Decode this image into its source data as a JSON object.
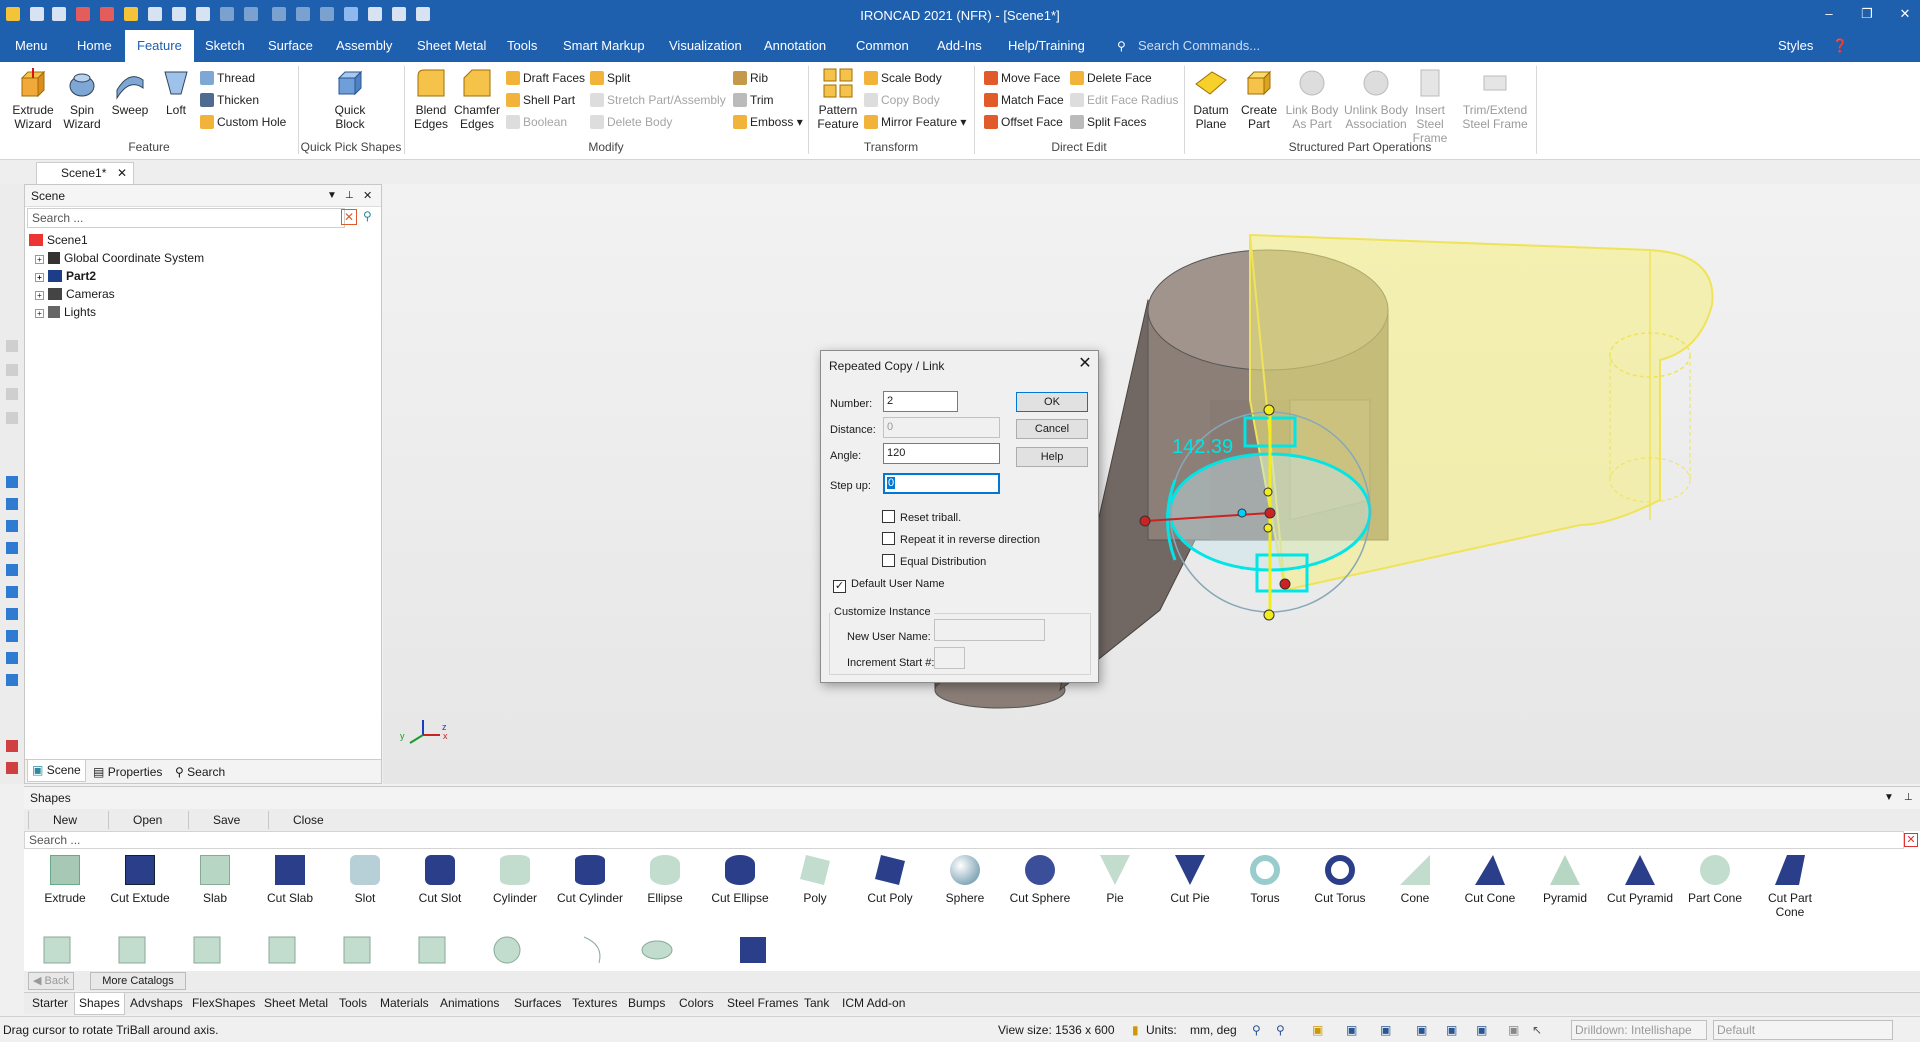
{
  "window": {
    "title": "IRONCAD 2021 (NFR) - [Scene1*]",
    "controls": [
      "–",
      "❐",
      "✕"
    ]
  },
  "menu": {
    "tabs": [
      "Menu",
      "Home",
      "Feature",
      "Sketch",
      "Surface",
      "Assembly",
      "Sheet Metal",
      "Tools",
      "Smart Markup",
      "Visualization",
      "Annotation",
      "Common",
      "Add-Ins",
      "Help/Training"
    ],
    "active": "Feature",
    "search_placeholder": "Search Commands...",
    "styles": "Styles"
  },
  "ribbon": {
    "groups": {
      "feature": "Feature",
      "quick": "Quick Pick Shapes",
      "modify": "Modify",
      "transform": "Transform",
      "direct": "Direct Edit",
      "structured": "Structured Part Operations"
    },
    "extrude": "Extrude Wizard",
    "spin": "Spin Wizard",
    "sweep": "Sweep",
    "loft": "Loft",
    "thread": "Thread",
    "thicken": "Thicken",
    "custom_hole": "Custom Hole",
    "quick_block": "Quick Block",
    "blend": "Blend Edges",
    "chamfer": "Chamfer Edges",
    "draft": "Draft Faces",
    "shell": "Shell Part",
    "boolean": "Boolean",
    "split": "Split",
    "stretch": "Stretch Part/Assembly",
    "delete_body": "Delete Body",
    "rib": "Rib",
    "trim": "Trim",
    "emboss": "Emboss",
    "pattern": "Pattern Feature",
    "scale": "Scale Body",
    "copy_body": "Copy Body",
    "mirror": "Mirror Feature",
    "move_face": "Move Face",
    "match_face": "Match Face",
    "offset_face": "Offset Face",
    "delete_face": "Delete Face",
    "edit_face_radius": "Edit Face Radius",
    "split_faces": "Split Faces",
    "datum": "Datum Plane",
    "create_part": "Create Part",
    "link_body": "Link Body As Part",
    "unlink_body": "Unlink Body Association",
    "insert_steel": "Insert Steel Frame",
    "trim_steel": "Trim/Extend Steel Frame"
  },
  "doc_tab": "Scene1*",
  "scene_panel": {
    "title": "Scene",
    "search": "Search ...",
    "root": "Scene1",
    "items": [
      "Global Coordinate System",
      "Part2",
      "Cameras",
      "Lights"
    ],
    "tabs": [
      "Scene",
      "Properties",
      "Search"
    ]
  },
  "viewport": {
    "dimension": "142.39",
    "axis": {
      "x": "x",
      "y": "y",
      "z": "z"
    }
  },
  "dialog": {
    "title": "Repeated Copy / Link",
    "number_label": "Number:",
    "number": "2",
    "distance_label": "Distance:",
    "distance": "0",
    "angle_label": "Angle:",
    "angle": "120",
    "stepup_label": "Step up:",
    "stepup": "0",
    "ok": "OK",
    "cancel": "Cancel",
    "help": "Help",
    "reset_triball": "Reset triball.",
    "reverse": "Repeat it in reverse direction",
    "equal": "Equal Distribution",
    "default_user_name": "Default User Name",
    "default_user_name_checked": true,
    "customize": "Customize Instance",
    "new_user_name": "New User Name:",
    "increment": "Increment Start #:"
  },
  "shapes": {
    "title": "Shapes",
    "toolbar": [
      "New",
      "Open",
      "Save",
      "Close"
    ],
    "search": "Search ...",
    "items": [
      "Extrude",
      "Cut Extude",
      "Slab",
      "Cut Slab",
      "Slot",
      "Cut Slot",
      "Cylinder",
      "Cut Cylinder",
      "Ellipse",
      "Cut Ellipse",
      "Poly",
      "Cut Poly",
      "Sphere",
      "Cut Sphere",
      "Pie",
      "Cut Pie",
      "Torus",
      "Cut Torus",
      "Cone",
      "Cut Cone",
      "Pyramid",
      "Cut Pyramid",
      "Part Cone",
      "Cut Part Cone"
    ],
    "back": "Back",
    "more": "More Catalogs"
  },
  "catalog_tabs": [
    "Starter",
    "Shapes",
    "Advshaps",
    "FlexShapes",
    "Sheet Metal",
    "Tools",
    "Materials",
    "Animations",
    "Surfaces",
    "Textures",
    "Bumps",
    "Colors",
    "Steel Frames",
    "Tank",
    "ICM Add-on"
  ],
  "catalog_active": "Shapes",
  "status": {
    "hint": "Drag cursor to rotate TriBall around axis.",
    "view_size": "View size: 1536 x  600",
    "units_label": "Units:",
    "units": "mm, deg",
    "drilldown": "Drilldown: Intellishape",
    "default": "Default"
  },
  "colors": {
    "brand": "#1e5fae",
    "highlight": "#00e5e5",
    "preview": "#f2ec6a"
  }
}
